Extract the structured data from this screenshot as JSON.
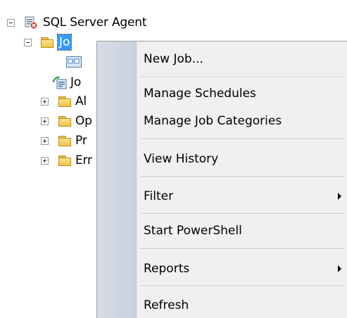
{
  "tree": {
    "root": {
      "label": "SQL Server Agent",
      "expanded": true
    },
    "children": [
      {
        "label": "Jobs",
        "visible_text": "Jo",
        "expanded": true,
        "selected": true
      },
      {
        "label": "Job activity",
        "visible_text": "Jo"
      },
      {
        "label": "Alerts",
        "visible_text": "Al"
      },
      {
        "label": "Operators",
        "visible_text": "Op"
      },
      {
        "label": "Proxies",
        "visible_text": "Pr"
      },
      {
        "label": "Error logs",
        "visible_text": "Err"
      }
    ]
  },
  "context_menu": {
    "items": [
      {
        "label": "New Job...",
        "has_submenu": false
      },
      {
        "label": "Manage Schedules",
        "has_submenu": false
      },
      {
        "label": "Manage Job Categories",
        "has_submenu": false
      },
      {
        "label": "View History",
        "has_submenu": false
      },
      {
        "label": "Filter",
        "has_submenu": true
      },
      {
        "label": "Start PowerShell",
        "has_submenu": false
      },
      {
        "label": "Reports",
        "has_submenu": true
      },
      {
        "label": "Refresh",
        "has_submenu": false
      }
    ]
  },
  "colors": {
    "selection": "#3399ff",
    "menu_background": "#f0f0f0",
    "menu_gutter": "#cfd6e0",
    "folder": "#f0c348"
  }
}
